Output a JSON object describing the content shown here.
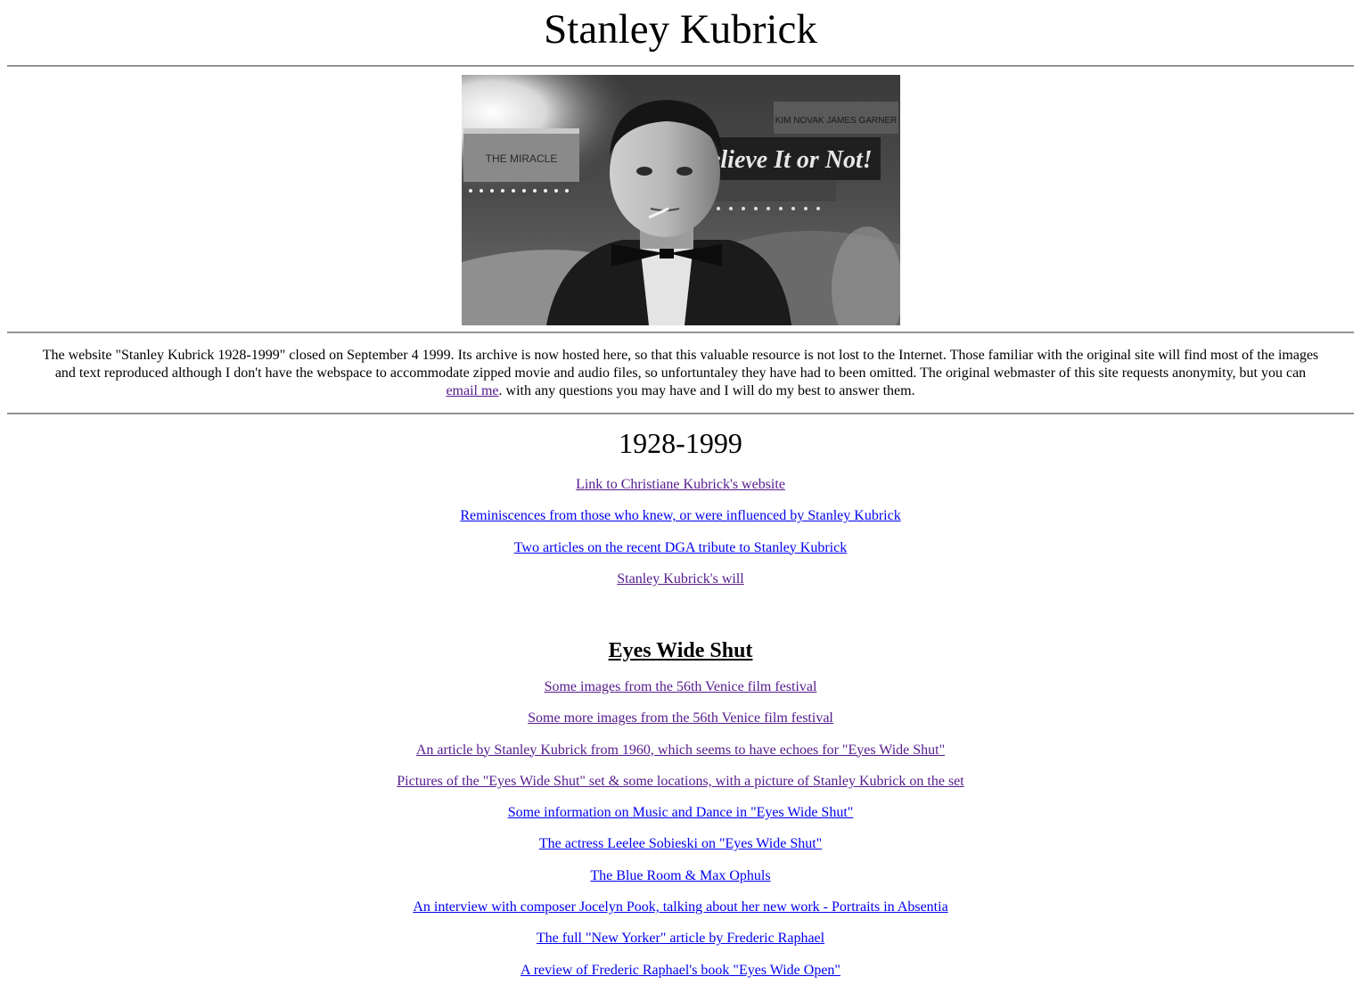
{
  "page": {
    "title": "Stanley Kubrick",
    "portrait_alt": "Stanley Kubrick in a tuxedo with a cigarette, in front of theater marquees",
    "portrait_signs": {
      "marquee_left": "THE MIRACLE",
      "marquee_big": "Believe It or Not!",
      "marquee_names": "KIM NOVAK JAMES GARNER"
    }
  },
  "intro": {
    "text_before_link": "The website \"Stanley Kubrick 1928-1999\" closed on September 4 1999. Its archive is now hosted here, so that this valuable resource is not lost to the Internet. Those familiar with the original site will find most of the images and text reproduced although I don't have the webspace to accommodate zipped movie and audio files, so unfortuntaley they have had to been omitted. The original webmaster of this site requests anonymity, but you can ",
    "email_link": "email me",
    "text_after_link": ". with any questions you may have and I will do my best to answer them."
  },
  "years": "1928-1999",
  "top_links": [
    {
      "label": "Link to Christiane Kubrick's website",
      "visited": true
    },
    {
      "label": "Reminiscences from those who knew, or were influenced by Stanley Kubrick",
      "visited": false
    },
    {
      "label": "Two articles on the recent DGA tribute to Stanley Kubrick",
      "visited": false
    },
    {
      "label": "Stanley Kubrick's will",
      "visited": true
    }
  ],
  "eyes_wide_shut": {
    "heading": "Eyes Wide Shut",
    "links": [
      {
        "label": "Some images from the 56th Venice film festival",
        "visited": true
      },
      {
        "label": "Some more images from the 56th Venice film festival",
        "visited": true
      },
      {
        "label": "An article by Stanley Kubrick from 1960, which seems to have echoes for \"Eyes Wide Shut\"",
        "visited": true
      },
      {
        "label": "Pictures of the \"Eyes Wide Shut\" set & some locations, with a picture of Stanley Kubrick on the set",
        "visited": true
      },
      {
        "label": "Some information on Music and Dance in \"Eyes Wide Shut\"",
        "visited": false
      },
      {
        "label": "The actress Leelee Sobieski on \"Eyes Wide Shut\"",
        "visited": false
      },
      {
        "label": "The Blue Room & Max Ophuls",
        "visited": false
      },
      {
        "label": "An interview with composer Jocelyn Pook, talking about her new work - Portraits in Absentia",
        "visited": false
      },
      {
        "label": "The full \"New Yorker\" article by Frederic Raphael",
        "visited": false
      },
      {
        "label": "A review of Frederic Raphael's book \"Eyes Wide Open\"",
        "visited": false
      }
    ]
  },
  "colors": {
    "link": "#0000ee",
    "visited_link": "#551a8b",
    "text": "#000000",
    "background": "#ffffff"
  }
}
